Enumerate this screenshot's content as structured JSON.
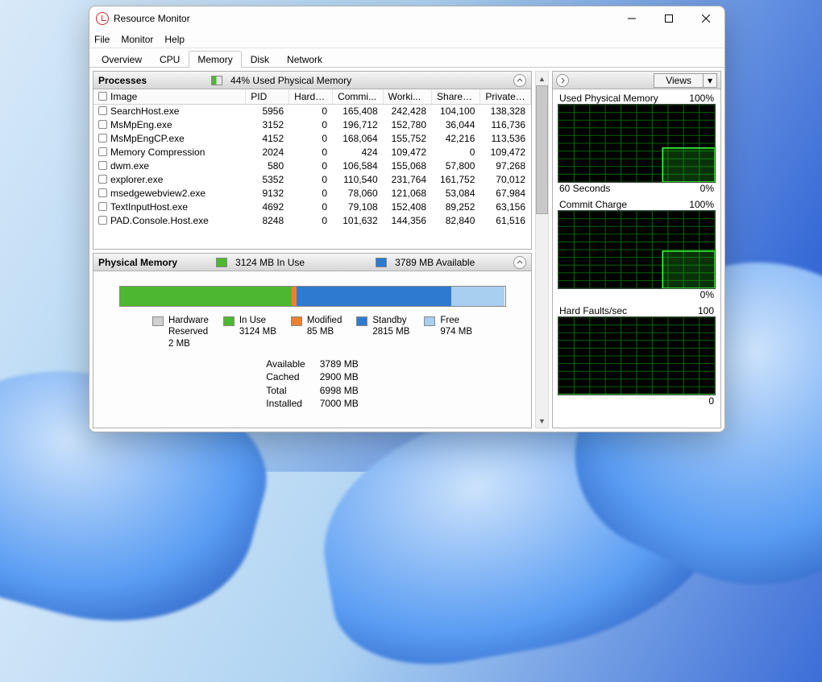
{
  "window": {
    "title": "Resource Monitor"
  },
  "menus": [
    "File",
    "Monitor",
    "Help"
  ],
  "tabs": [
    "Overview",
    "CPU",
    "Memory",
    "Disk",
    "Network"
  ],
  "active_tab": "Memory",
  "processes_panel": {
    "title": "Processes",
    "subtitle": "44% Used Physical Memory"
  },
  "proc_columns": [
    "Image",
    "PID",
    "Hard F...",
    "Commi...",
    "Worki...",
    "Sharea...",
    "Private ..."
  ],
  "processes": [
    {
      "image": "SearchHost.exe",
      "pid": "5956",
      "hf": "0",
      "commit": "165,408",
      "working": "242,428",
      "share": "104,100",
      "priv": "138,328"
    },
    {
      "image": "MsMpEng.exe",
      "pid": "3152",
      "hf": "0",
      "commit": "196,712",
      "working": "152,780",
      "share": "36,044",
      "priv": "116,736"
    },
    {
      "image": "MsMpEngCP.exe",
      "pid": "4152",
      "hf": "0",
      "commit": "168,064",
      "working": "155,752",
      "share": "42,216",
      "priv": "113,536"
    },
    {
      "image": "Memory Compression",
      "pid": "2024",
      "hf": "0",
      "commit": "424",
      "working": "109,472",
      "share": "0",
      "priv": "109,472"
    },
    {
      "image": "dwm.exe",
      "pid": "580",
      "hf": "0",
      "commit": "106,584",
      "working": "155,068",
      "share": "57,800",
      "priv": "97,268"
    },
    {
      "image": "explorer.exe",
      "pid": "5352",
      "hf": "0",
      "commit": "110,540",
      "working": "231,764",
      "share": "161,752",
      "priv": "70,012"
    },
    {
      "image": "msedgewebview2.exe",
      "pid": "9132",
      "hf": "0",
      "commit": "78,060",
      "working": "121,068",
      "share": "53,084",
      "priv": "67,984"
    },
    {
      "image": "TextInputHost.exe",
      "pid": "4692",
      "hf": "0",
      "commit": "79,108",
      "working": "152,408",
      "share": "89,252",
      "priv": "63,156"
    },
    {
      "image": "PAD.Console.Host.exe",
      "pid": "8248",
      "hf": "0",
      "commit": "101,632",
      "working": "144,356",
      "share": "82,840",
      "priv": "61,516"
    }
  ],
  "phys_panel": {
    "title": "Physical Memory",
    "inuse_label": "3124 MB In Use",
    "avail_label": "3789 MB Available"
  },
  "mem_bar": {
    "hardware_reserved_mb": 2,
    "inuse_mb": 3124,
    "modified_mb": 85,
    "standby_mb": 2815,
    "free_mb": 974,
    "total_mb": 6998
  },
  "legend": {
    "hw": {
      "title": "Hardware",
      "sub": "Reserved",
      "val": "2 MB"
    },
    "inuse": {
      "title": "In Use",
      "val": "3124 MB"
    },
    "mod": {
      "title": "Modified",
      "val": "85 MB"
    },
    "standby": {
      "title": "Standby",
      "val": "2815 MB"
    },
    "free": {
      "title": "Free",
      "val": "974 MB"
    }
  },
  "mem_stats": {
    "labels": {
      "available": "Available",
      "cached": "Cached",
      "total": "Total",
      "installed": "Installed"
    },
    "values": {
      "available": "3789 MB",
      "cached": "2900 MB",
      "total": "6998 MB",
      "installed": "7000 MB"
    }
  },
  "right": {
    "views": "Views",
    "graph1": {
      "title": "Used Physical Memory",
      "max": "100%",
      "xlabel": "60 Seconds",
      "xr": "0%"
    },
    "graph2": {
      "title": "Commit Charge",
      "max": "100%",
      "xr": "0%"
    },
    "graph3": {
      "title": "Hard Faults/sec",
      "max": "100",
      "xr": "0"
    }
  },
  "chart_data": [
    {
      "type": "line",
      "title": "Used Physical Memory",
      "ylabel": "%",
      "ylim": [
        0,
        100
      ],
      "xlabel": "60 Seconds",
      "x": [
        0,
        10,
        20,
        30,
        40,
        50,
        60
      ],
      "values": [
        null,
        null,
        null,
        null,
        44,
        44,
        44
      ]
    },
    {
      "type": "line",
      "title": "Commit Charge",
      "ylabel": "%",
      "ylim": [
        0,
        100
      ],
      "x": [
        0,
        10,
        20,
        30,
        40,
        50,
        60
      ],
      "values": [
        null,
        null,
        null,
        null,
        48,
        48,
        48
      ]
    },
    {
      "type": "line",
      "title": "Hard Faults/sec",
      "ylabel": "",
      "ylim": [
        0,
        100
      ],
      "x": [
        0,
        10,
        20,
        30,
        40,
        50,
        60
      ],
      "values": [
        0,
        0,
        0,
        0,
        0,
        0,
        0
      ]
    }
  ]
}
